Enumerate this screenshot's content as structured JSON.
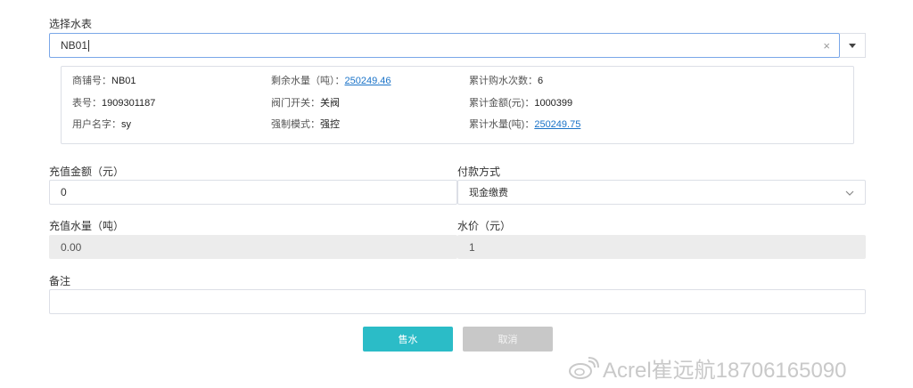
{
  "meter_select": {
    "label": "选择水表",
    "value": "NB01",
    "clear_icon": "close-icon",
    "toggle_icon": "caret-down-icon"
  },
  "meter_info": {
    "shop_no_label": "商铺号：",
    "shop_no": "NB01",
    "meter_no_label": "表号：",
    "meter_no": "1909301187",
    "user_name_label": "用户名字：",
    "user_name": "sy",
    "remaining_label": "剩余水量（吨）：",
    "remaining": "250249.46",
    "valve_label": "阀门开关：",
    "valve": "关阀",
    "force_mode_label": "强制模式：",
    "force_mode": "强控",
    "purchase_count_label": "累计购水次数：",
    "purchase_count": "6",
    "total_amount_label": "累计金额(元)：",
    "total_amount": "1000399",
    "total_water_label": "累计水量(吨)：",
    "total_water": "250249.75"
  },
  "form": {
    "amount_label": "充值金额（元）",
    "amount_value": "0",
    "payment_label": "付款方式",
    "payment_value": "现金缴费",
    "water_label": "充值水量（吨）",
    "water_value": "0.00",
    "price_label": "水价（元）",
    "price_value": "1",
    "remark_label": "备注",
    "remark_value": ""
  },
  "buttons": {
    "sell": "售水",
    "cancel": "取消"
  },
  "watermark": {
    "text": "Acrel崔远航18706165090",
    "icon": "weibo-icon"
  },
  "colors": {
    "primary": "#2bbcc7",
    "link": "#1a73c8",
    "cancel": "#c8c8c8",
    "focus_border": "#7aa7e8"
  }
}
